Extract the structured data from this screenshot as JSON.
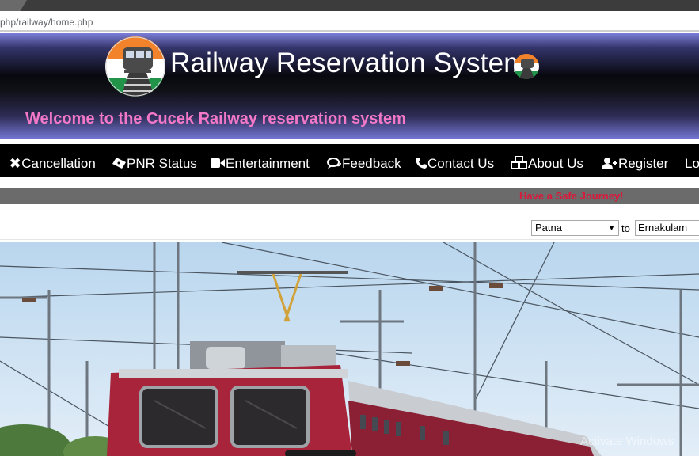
{
  "browser": {
    "address": "php/railway/home.php"
  },
  "header": {
    "title": "Railway Reservation System",
    "welcome": "Welcome to the Cucek Railway reservation system"
  },
  "nav": {
    "items": [
      {
        "icon": "close-icon",
        "label": "Cancellation"
      },
      {
        "icon": "ticket-icon",
        "label": "PNR Status"
      },
      {
        "icon": "video-camera-icon",
        "label": "Entertainment"
      },
      {
        "icon": "comments-icon",
        "label": "Feedback"
      },
      {
        "icon": "phone-icon",
        "label": "Contact Us"
      },
      {
        "icon": "cubes-icon",
        "label": "About Us"
      },
      {
        "icon": "user-plus-icon",
        "label": "Register"
      },
      {
        "icon": "",
        "label": "Lo"
      }
    ]
  },
  "marquee": "Have a Safe Journey!",
  "search": {
    "from": "Patna",
    "to_label": "to",
    "to": "Ernakulam"
  },
  "watermark": "Activate Windows",
  "colors": {
    "welcome": "#f478c8",
    "marquee": "#d91a3c",
    "nav_bg": "#000000"
  }
}
